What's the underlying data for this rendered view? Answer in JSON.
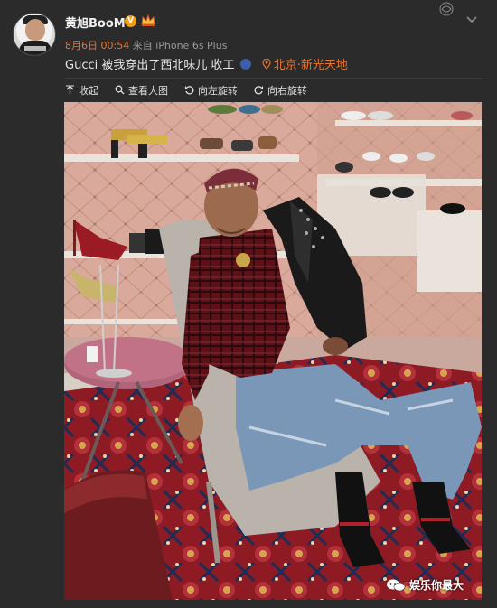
{
  "post": {
    "username": "黄旭BooM",
    "v_badge": "V",
    "date": "8月6日 00:54",
    "source": "来自 iPhone 6s Plus",
    "text": "Gucci 被我穿出了西北味儿  收工",
    "location": "北京·新光天地"
  },
  "toolbar": {
    "collapse": "收起",
    "view_large": "查看大图",
    "rotate_left": "向左旋转",
    "rotate_right": "向右旋转"
  },
  "watermark": "娱乐你最大",
  "colors": {
    "accent": "#e8732c",
    "background": "#2b2b2b"
  },
  "icons": [
    "up-arrow-icon",
    "magnifier-icon",
    "rotate-left-icon",
    "rotate-right-icon",
    "location-pin-icon",
    "chevron-down-icon",
    "moon-icon",
    "wechat-icon"
  ]
}
